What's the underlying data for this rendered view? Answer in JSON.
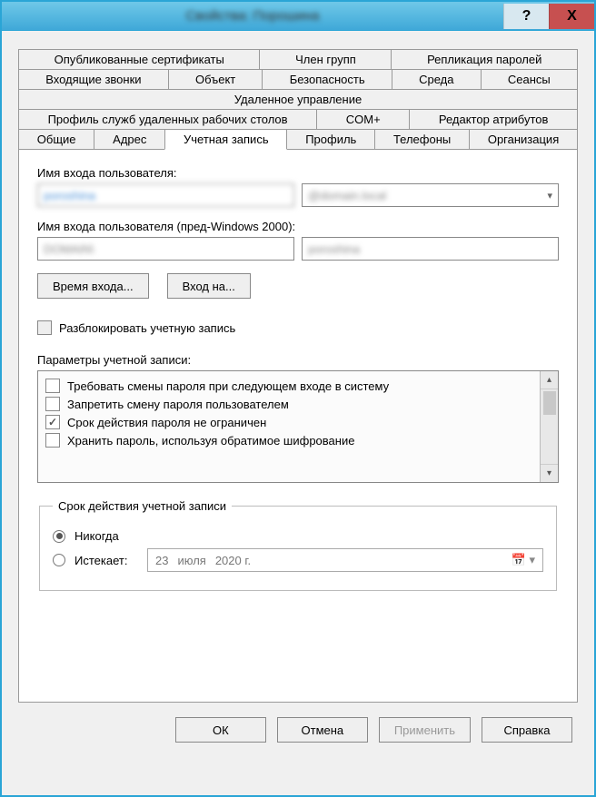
{
  "window": {
    "title": "Свойства: Порошина",
    "help": "?",
    "close": "X"
  },
  "tabs": {
    "row1": [
      "Опубликованные сертификаты",
      "Член групп",
      "Репликация паролей"
    ],
    "row2": [
      "Входящие звонки",
      "Объект",
      "Безопасность",
      "Среда",
      "Сеансы"
    ],
    "row3": [
      "Удаленное управление"
    ],
    "row4": [
      "Профиль служб удаленных рабочих столов",
      "COM+",
      "Редактор атрибутов"
    ],
    "row5": [
      "Общие",
      "Адрес",
      "Учетная запись",
      "Профиль",
      "Телефоны",
      "Организация"
    ],
    "active": "Учетная запись"
  },
  "account": {
    "logon_label": "Имя входа пользователя:",
    "logon_value": "poroshina",
    "upn_suffix": "@domain.local",
    "prewin_label": "Имя входа пользователя (пред-Windows 2000):",
    "prewin_domain": "DOMAIN\\",
    "prewin_user": "poroshina",
    "btn_logon_hours": "Время входа...",
    "btn_logon_to": "Вход на...",
    "unlock_label": "Разблокировать учетную запись",
    "options_label": "Параметры учетной записи:",
    "options": [
      {
        "label": "Требовать смены пароля при следующем входе в систему",
        "checked": false
      },
      {
        "label": "Запретить смену пароля пользователем",
        "checked": false
      },
      {
        "label": "Срок действия пароля не ограничен",
        "checked": true
      },
      {
        "label": "Хранить пароль, используя обратимое шифрование",
        "checked": false
      }
    ],
    "expires": {
      "legend": "Срок действия учетной записи",
      "never": "Никогда",
      "ends": "Истекает:",
      "date_day": "23",
      "date_month": "июля",
      "date_year": "2020 г."
    }
  },
  "buttons": {
    "ok": "ОК",
    "cancel": "Отмена",
    "apply": "Применить",
    "help": "Справка"
  }
}
